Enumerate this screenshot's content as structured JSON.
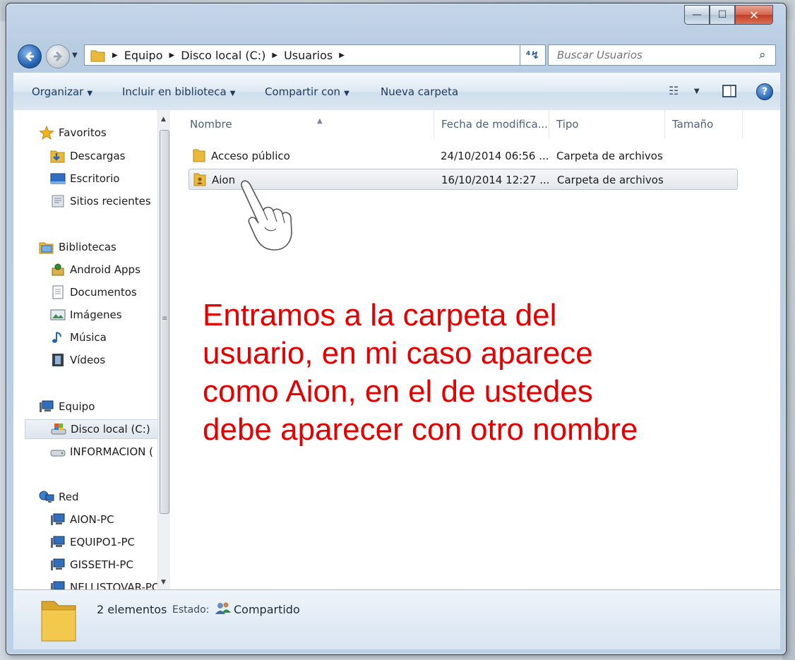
{
  "window": {
    "caption": {
      "minimize": "—",
      "maximize": "☐",
      "close": "✕"
    }
  },
  "address": {
    "crumbs": [
      "Equipo",
      "Disco local (C:)",
      "Usuarios"
    ],
    "search_placeholder": "Buscar Usuarios"
  },
  "toolbar": {
    "organize": "Organizar",
    "include": "Incluir en biblioteca",
    "share": "Compartir con",
    "new_folder": "Nueva carpeta"
  },
  "nav": {
    "favorites": "Favoritos",
    "downloads": "Descargas",
    "desktop": "Escritorio",
    "recent": "Sitios recientes",
    "libraries": "Bibliotecas",
    "android": "Android Apps",
    "documents": "Documentos",
    "images": "Imágenes",
    "music": "Música",
    "videos": "Vídeos",
    "computer": "Equipo",
    "local_disk": "Disco local (C:)",
    "info_drive": "INFORMACION (",
    "network": "Red",
    "pc1": "AION-PC",
    "pc2": "EQUIPO1-PC",
    "pc3": "GISSETH-PC",
    "pc4": "NELLISTOVAR-PC"
  },
  "columns": {
    "name": "Nombre",
    "date": "Fecha de modifica...",
    "type": "Tipo",
    "size": "Tamaño"
  },
  "files": [
    {
      "name": "Acceso público",
      "date": "24/10/2014 06:56 ...",
      "type": "Carpeta de archivos"
    },
    {
      "name": "Aion",
      "date": "16/10/2014 12:27 ...",
      "type": "Carpeta de archivos"
    }
  ],
  "annotation": {
    "line1": "Entramos a la carpeta del",
    "line2": "usuario, en mi caso aparece",
    "line3": "como Aion, en el de ustedes",
    "line4": "debe aparecer con otro nombre"
  },
  "status": {
    "count": "2 elementos",
    "state_label": "Estado:",
    "state_value": "Compartido"
  },
  "colors": {
    "annotation": "#e30000",
    "toolbar_text": "#1e395b"
  }
}
